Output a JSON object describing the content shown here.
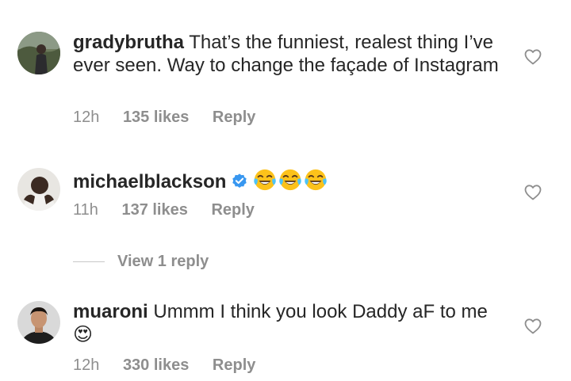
{
  "comments": [
    {
      "username": "gradybrutha",
      "text": "That’s the funniest, realest thing I’ve ever seen. Way to change the façade of Instagram",
      "time": "12h",
      "likes": "135 likes",
      "reply": "Reply"
    },
    {
      "username": "michaelblackson",
      "verified": true,
      "text": "😂😂😂",
      "time": "11h",
      "likes": "137 likes",
      "reply": "Reply",
      "view_replies": "View 1 reply"
    },
    {
      "username": "muaroni",
      "text": "Ummm I think you look Daddy aF to me 😍",
      "time": "12h",
      "likes": "330 likes",
      "reply": "Reply"
    }
  ],
  "icons": {
    "like": "heart-outline-icon",
    "verified": "verified-badge-icon",
    "emoji_joy": "face-with-tears-of-joy-icon",
    "emoji_heart_eyes": "smiling-face-with-heart-eyes-icon"
  },
  "colors": {
    "text": "#262626",
    "secondary": "#8e8e8e",
    "verified": "#3897f0",
    "emoji": "#fcc21b",
    "heart_eyes": "#e8344e"
  }
}
